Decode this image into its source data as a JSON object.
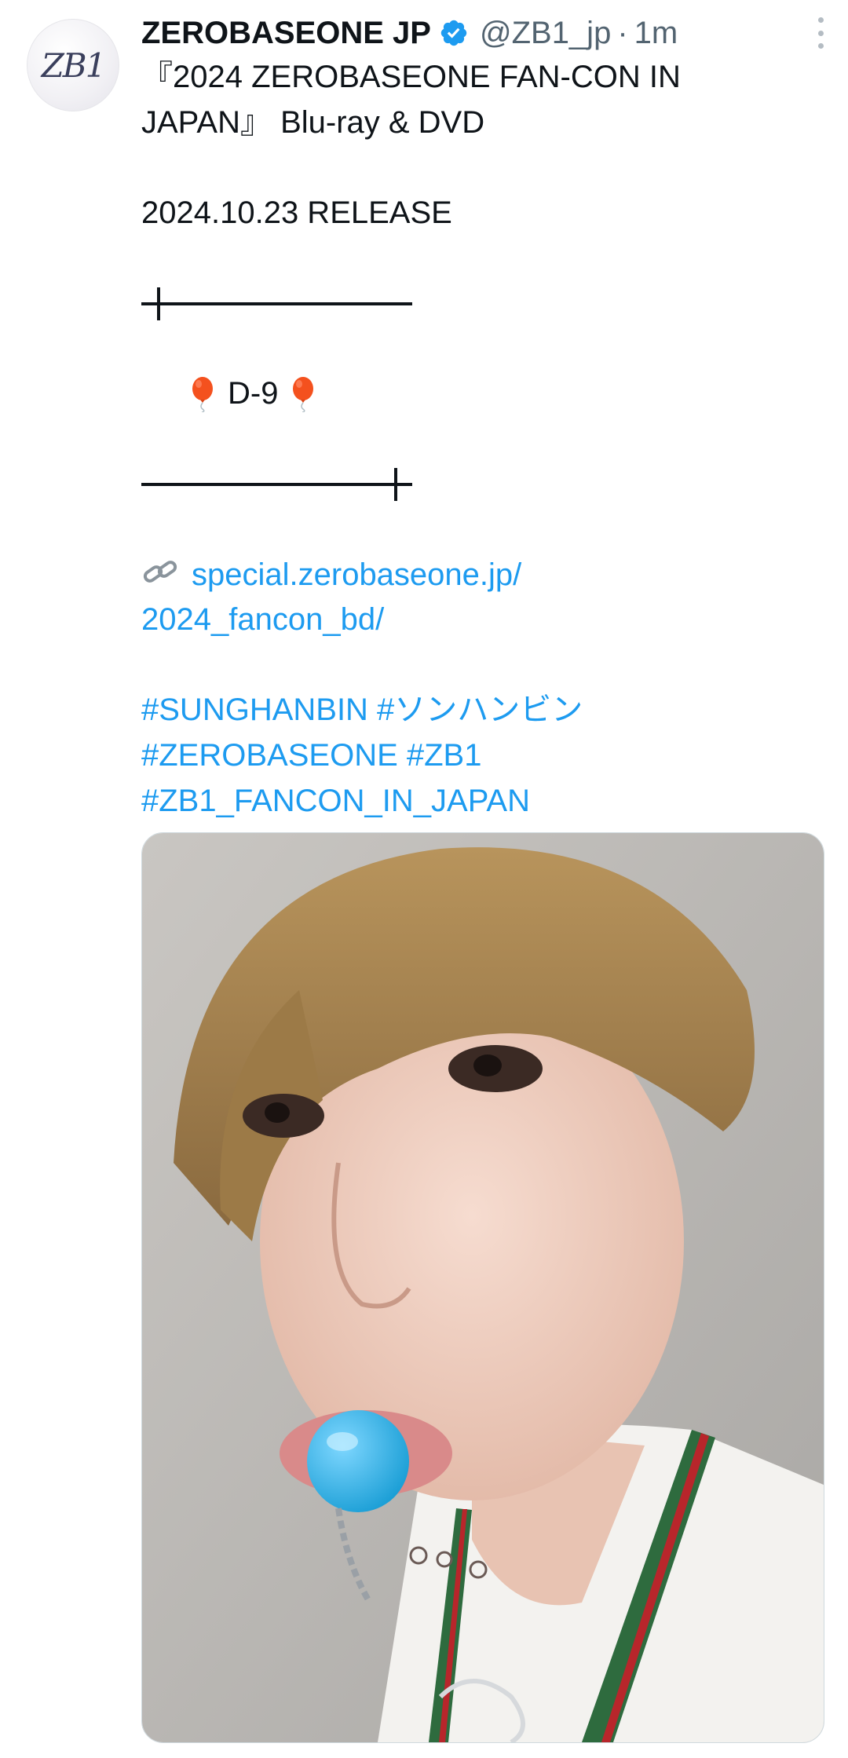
{
  "tweet": {
    "display_name": "ZEROBASEONE JP",
    "verified_icon": "verified-badge-icon",
    "handle": "@ZB1_jp",
    "separator": "·",
    "time": "1m",
    "more_icon": "more-vertical-icon",
    "avatar": {
      "logo_text": "ZB1"
    },
    "text": {
      "line1": "『2024 ZEROBASEONE FAN-CON IN",
      "line2": "JAPAN』 Blu-ray & DVD",
      "release": "2024.10.23 RELEASE",
      "countdown": "D-9",
      "countdown_icon": "balloon-icon",
      "link_icon": "link-icon",
      "link_line1": "special.zerobaseone.jp/",
      "link_line2": "2024_fancon_bd/",
      "hashtags_line1": "#SUNGHANBIN #ソンハンビン",
      "hashtags_line2": "#ZEROBASEONE #ZB1",
      "hashtags_line3": "#ZB1_FANCON_IN_JAPAN"
    },
    "media": {
      "type": "photo"
    }
  },
  "colors": {
    "text": "#0f1419",
    "secondary": "#536471",
    "link": "#1d9bf0",
    "verified": "#1d9bf0",
    "balloon": "#f4511e"
  }
}
